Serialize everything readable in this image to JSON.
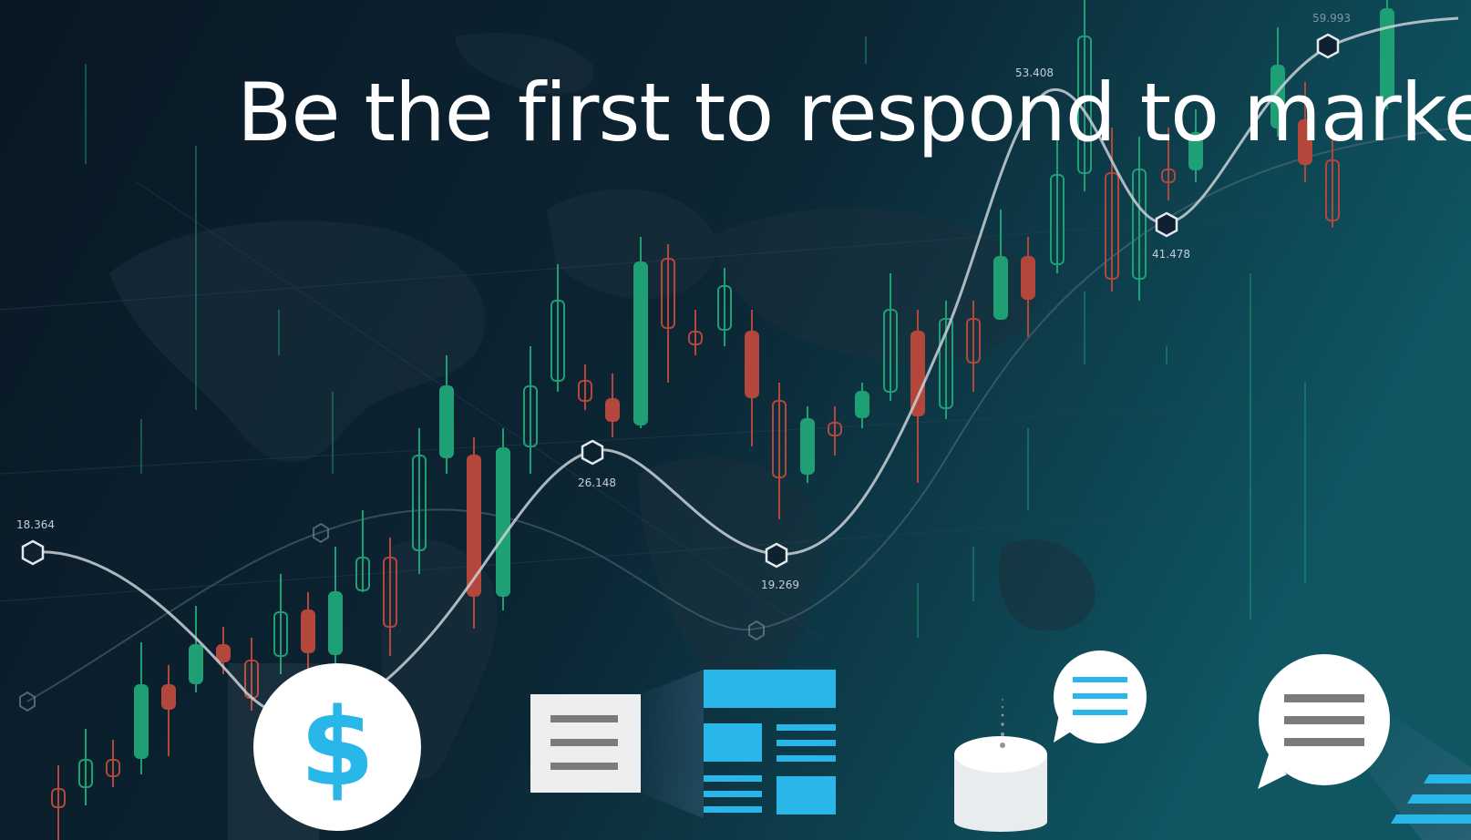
{
  "headline": "Be the first to respond to marke",
  "colors": {
    "background_dark": "#0b1a26",
    "background_teal": "#0e4a56",
    "candle_up": "#1f9f74",
    "candle_down": "#b3473c",
    "accent_blue": "#29b6e8",
    "icon_white": "#ffffff",
    "icon_gray": "#7a7a7a"
  },
  "value_labels": [
    "18.364",
    "26.148",
    "19.269",
    "53.408",
    "41.478",
    "59.993"
  ],
  "icons": {
    "currency": "dollar-icon",
    "document": "document-icon",
    "layout": "dashboard-layout-icon",
    "database": "database-icon",
    "message_small": "chat-bubble-icon",
    "message_large": "chat-bubble-icon"
  },
  "dollar_symbol": "$"
}
